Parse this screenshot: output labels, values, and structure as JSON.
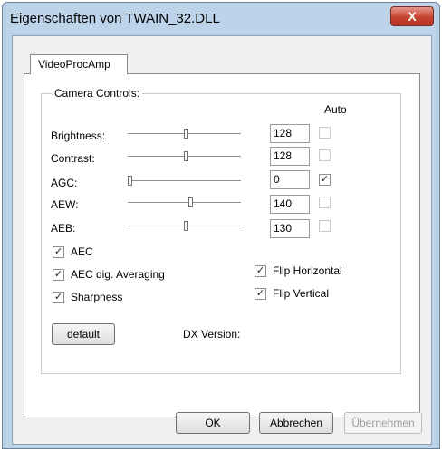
{
  "window": {
    "title": "Eigenschaften von TWAIN_32.DLL",
    "close_label": "X"
  },
  "tab": {
    "label": "VideoProcAmp"
  },
  "group": {
    "label": "Camera Controls:",
    "auto_header": "Auto"
  },
  "controls": [
    {
      "label": "Brightness:",
      "value": "128",
      "level": 0.52,
      "auto": false
    },
    {
      "label": "Contrast:",
      "value": "128",
      "level": 0.52,
      "auto": false
    },
    {
      "label": "AGC:",
      "value": "0",
      "level": 0.0,
      "auto": true
    },
    {
      "label": "AEW:",
      "value": "140",
      "level": 0.56,
      "auto": false
    },
    {
      "label": "AEB:",
      "value": "130",
      "level": 0.52,
      "auto": false
    }
  ],
  "options_left": [
    {
      "label": "AEC",
      "checked": true
    },
    {
      "label": "AEC dig. Averaging",
      "checked": true
    },
    {
      "label": "Sharpness",
      "checked": true
    }
  ],
  "options_right": [
    {
      "label": "Flip Horizontal",
      "checked": true
    },
    {
      "label": "Flip Vertical",
      "checked": true
    }
  ],
  "default_button": "default",
  "dx_version_label": "DX Version:",
  "buttons": {
    "ok": "OK",
    "cancel": "Abbrechen",
    "apply": "Übernehmen"
  },
  "check_glyph": "✓"
}
